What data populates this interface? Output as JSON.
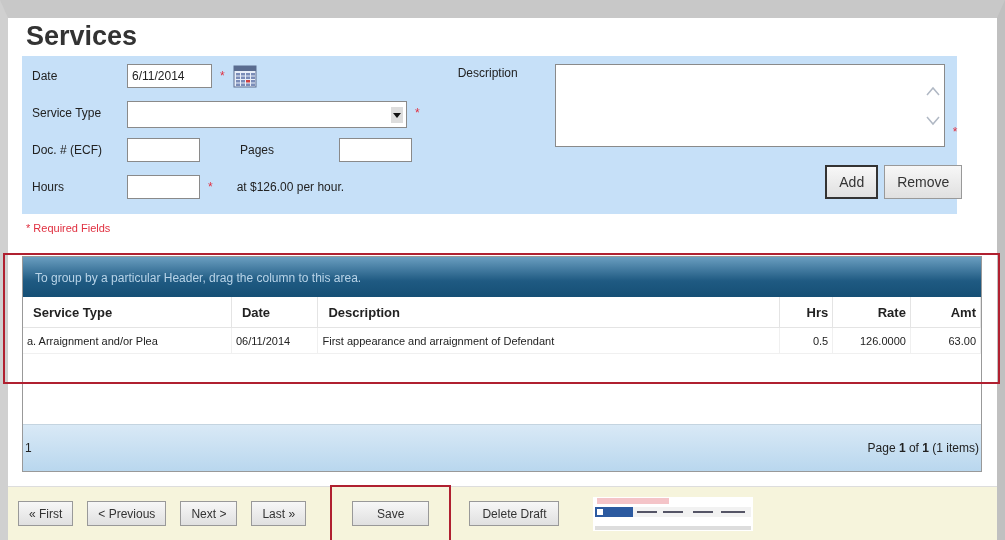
{
  "title": "Services",
  "required_mark": "*",
  "form": {
    "date": {
      "label": "Date",
      "value": "6/11/2014",
      "required": true
    },
    "service_type": {
      "label": "Service Type",
      "required": true
    },
    "doc": {
      "label": "Doc. # (ECF)"
    },
    "pages": {
      "label": "Pages"
    },
    "hours": {
      "label": "Hours",
      "required": true,
      "note": "at $126.00 per hour."
    },
    "description": {
      "label": "Description",
      "required": true
    },
    "buttons": [
      {
        "label": "Add",
        "focused": true
      },
      {
        "label": "Remove",
        "focused": false
      }
    ]
  },
  "required_note": "* Required Fields",
  "grid": {
    "highlighted": true,
    "group_hint": "To group by a particular Header, drag the column to this area.",
    "columns": [
      {
        "label": "Service Type"
      },
      {
        "label": "Date"
      },
      {
        "label": "Description"
      },
      {
        "label": "Hrs"
      },
      {
        "label": "Rate"
      },
      {
        "label": "Amt"
      }
    ],
    "rows": [
      {
        "cells": [
          "a. Arraignment and/or Plea",
          "06/11/2014",
          "First appearance and arraignment of Defendant",
          "0.5",
          "126.0000",
          "63.00"
        ]
      }
    ],
    "pager": {
      "count": "1",
      "page_text": "Page **1** of **1** (1 items)"
    }
  },
  "nav_buttons": [
    "« First",
    "< Previous",
    "Next >",
    "Last »"
  ],
  "actions": [
    {
      "label": "Save",
      "highlighted": true
    },
    {
      "label": "Delete Draft",
      "highlighted": false
    }
  ]
}
